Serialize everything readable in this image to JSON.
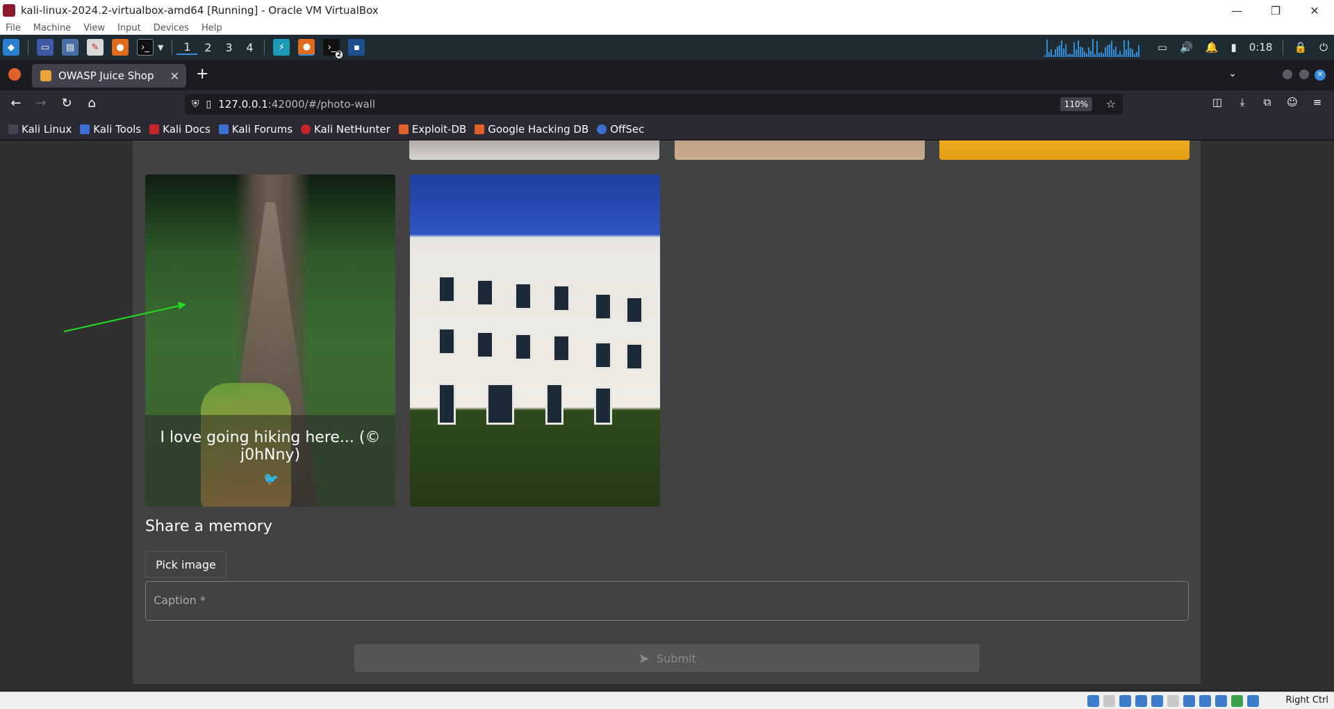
{
  "vbox": {
    "title": "kali-linux-2024.2-virtualbox-amd64 [Running] - Oracle VM VirtualBox",
    "menu": [
      "File",
      "Machine",
      "View",
      "Input",
      "Devices",
      "Help"
    ],
    "window_controls": {
      "minimize": "—",
      "restore": "❐",
      "close": "✕"
    },
    "status_host_key": "Right Ctrl"
  },
  "kali_panel": {
    "workspaces": [
      "1",
      "2",
      "3",
      "4"
    ],
    "terminal_badge": "2",
    "clock": "0:18"
  },
  "browser": {
    "tab_title": "OWASP Juice Shop",
    "new_tab": "+",
    "url_host": "127.0.0.1",
    "url_path": ":42000/#/photo-wall",
    "zoom": "110%",
    "bookmarks": [
      "Kali Linux",
      "Kali Tools",
      "Kali Docs",
      "Kali Forums",
      "Kali NetHunter",
      "Exploit-DB",
      "Google Hacking DB",
      "OffSec"
    ]
  },
  "photo_wall": {
    "hike_caption": "I love going hiking here... (© j0hNny)",
    "share_title": "Share a memory",
    "pick_image_label": "Pick image",
    "caption_placeholder": "Caption *",
    "submit_label": "Submit"
  }
}
